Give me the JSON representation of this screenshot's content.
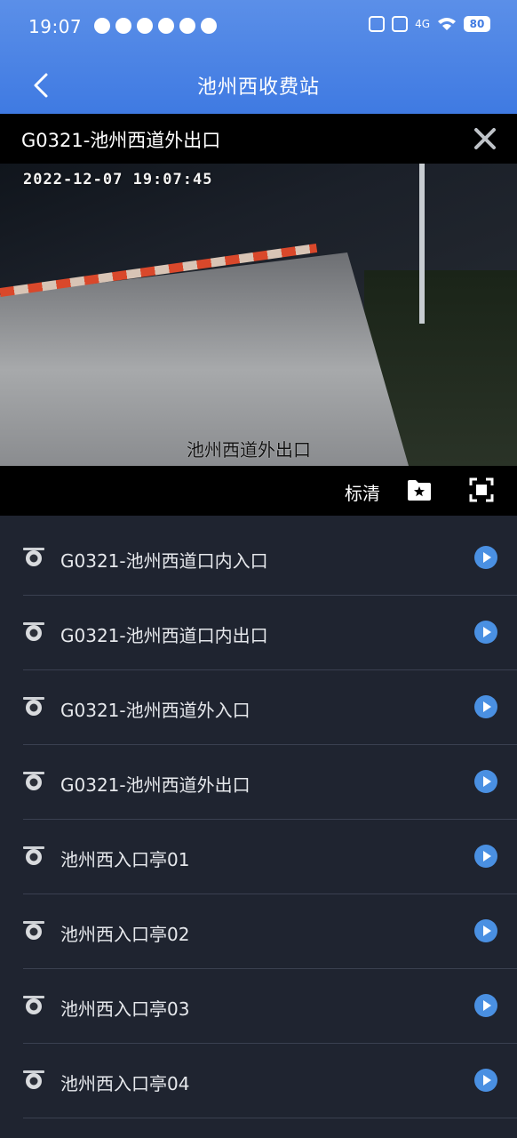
{
  "status": {
    "time": "19:07",
    "battery": "80",
    "network": "4G"
  },
  "nav": {
    "title": "池州西收费站"
  },
  "player": {
    "title": "G0321-池州西道外出口",
    "osd_timestamp": "2022-12-07 19:07:45",
    "osd_label": "池州西道外出口",
    "quality_label": "标清"
  },
  "cameras": [
    {
      "label": "G0321-池州西道口内入口"
    },
    {
      "label": "G0321-池州西道口内出口"
    },
    {
      "label": "G0321-池州西道外入口"
    },
    {
      "label": "G0321-池州西道外出口"
    },
    {
      "label": "池州西入口亭01"
    },
    {
      "label": "池州西入口亭02"
    },
    {
      "label": "池州西入口亭03"
    },
    {
      "label": "池州西入口亭04"
    }
  ],
  "colors": {
    "header_blue": "#3f7ae2",
    "list_bg": "#1f2430",
    "play_blue": "#4a90e2"
  }
}
